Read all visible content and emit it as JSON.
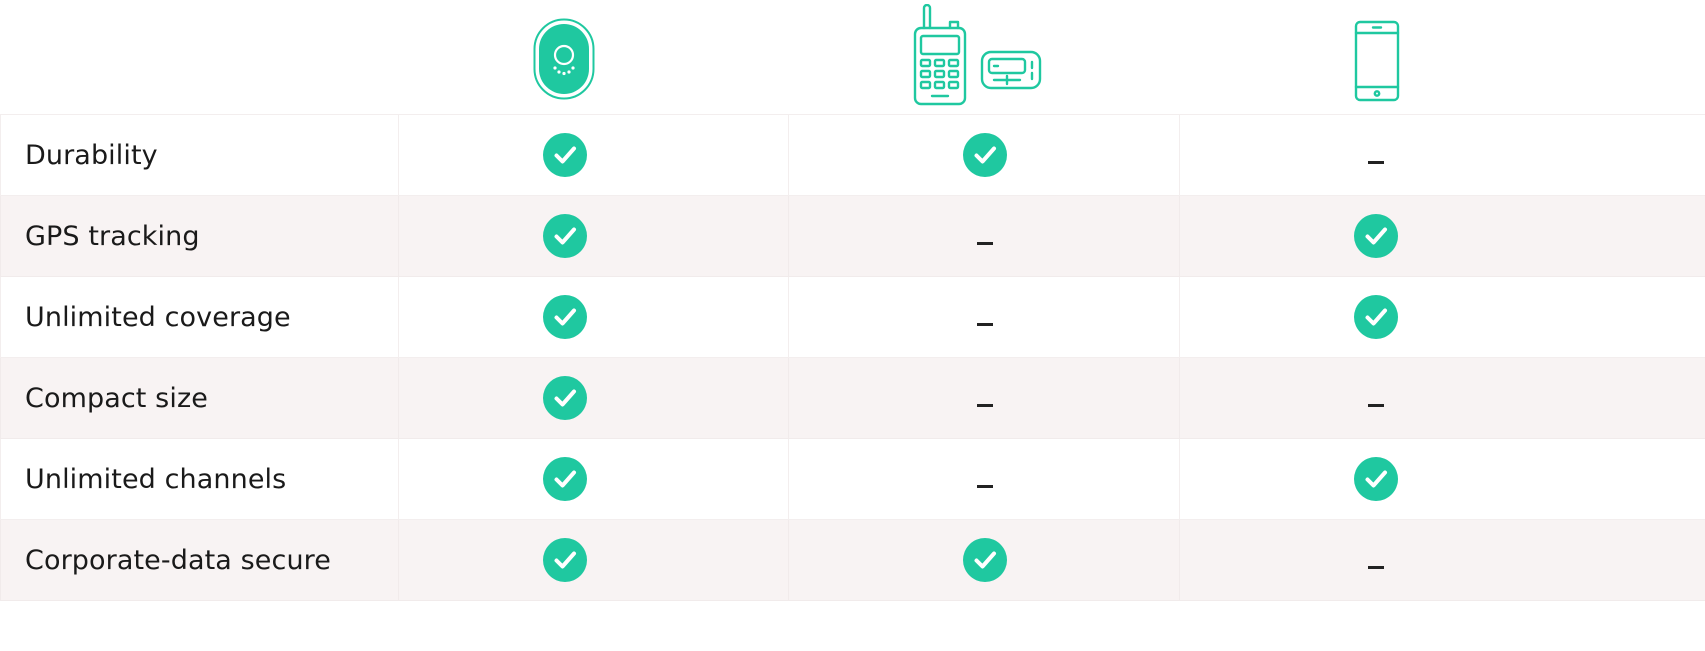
{
  "columns": [
    {
      "icon": "smart-badge-device-icon"
    },
    {
      "icon": "walkie-talkie-and-pager-icon"
    },
    {
      "icon": "smartphone-icon"
    }
  ],
  "rows": [
    {
      "feature": "Durability",
      "values": [
        "check",
        "check",
        "dash"
      ]
    },
    {
      "feature": "GPS tracking",
      "values": [
        "check",
        "dash",
        "check"
      ]
    },
    {
      "feature": "Unlimited coverage",
      "values": [
        "check",
        "dash",
        "check"
      ]
    },
    {
      "feature": "Compact size",
      "values": [
        "check",
        "dash",
        "dash"
      ]
    },
    {
      "feature": "Unlimited channels",
      "values": [
        "check",
        "dash",
        "check"
      ]
    },
    {
      "feature": "Corporate-data secure",
      "values": [
        "check",
        "check",
        "dash"
      ]
    }
  ],
  "colors": {
    "accent": "#1fc8a0",
    "row_alt": "#f8f3f3",
    "text": "#1a1a1a"
  }
}
